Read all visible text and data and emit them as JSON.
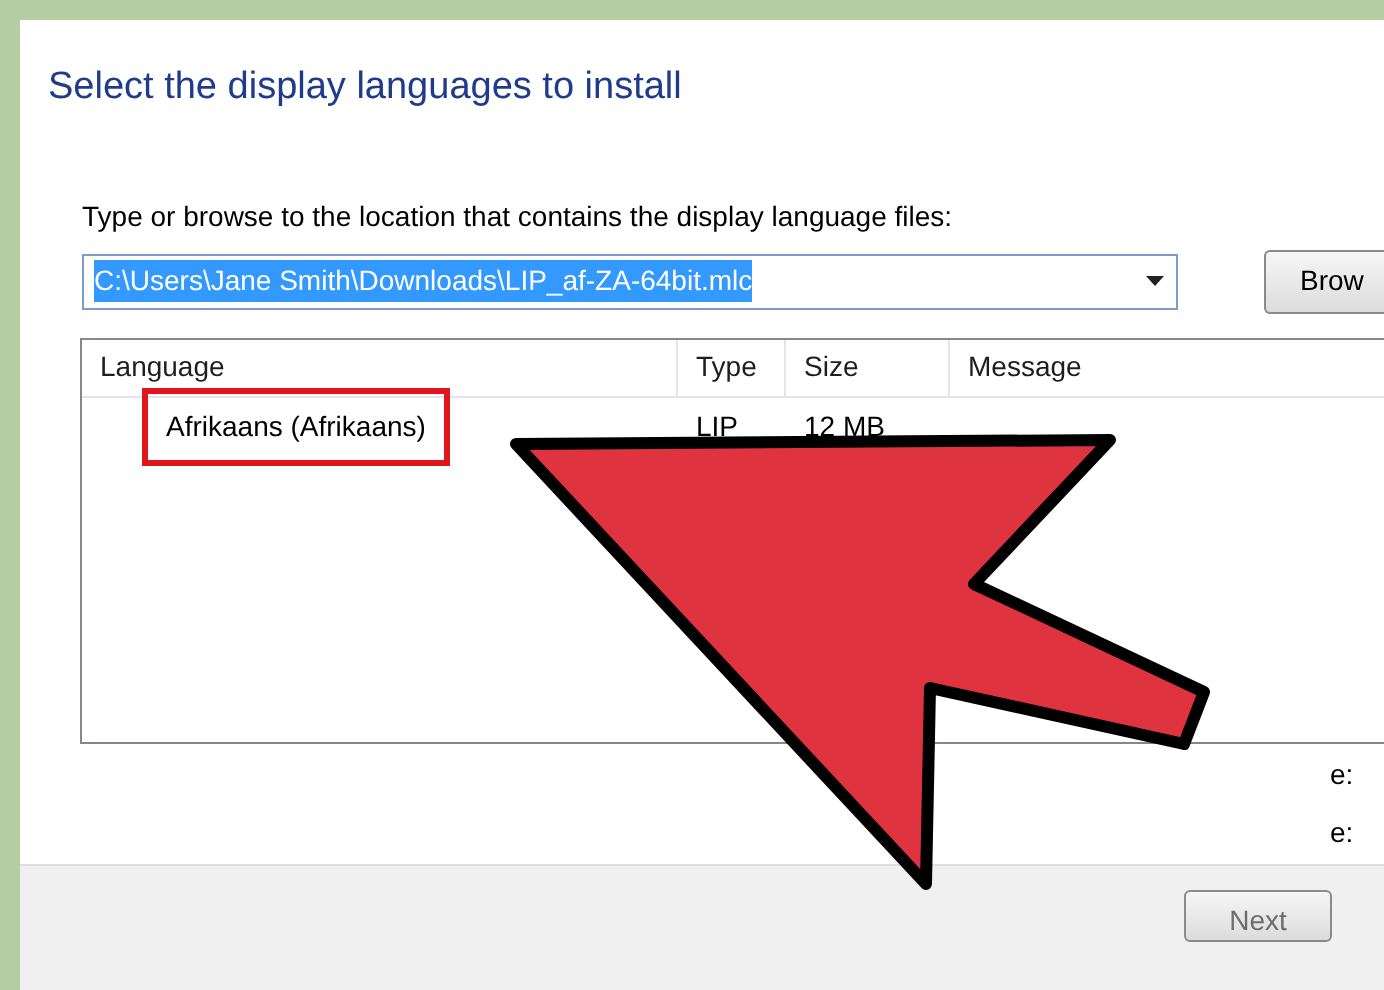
{
  "heading": "Select the display languages to install",
  "path_label": "Type or browse to the location that contains the display language files:",
  "path_field": {
    "value": "C:\\Users\\Jane Smith\\Downloads\\LIP_af-ZA-64bit.mlc",
    "text_selected": true
  },
  "browse_button": "Brow",
  "table": {
    "columns": [
      "Language",
      "Type",
      "Size",
      "Message"
    ],
    "rows": [
      {
        "language": "Afrikaans (Afrikaans)",
        "type": "LIP",
        "size": "12 MB",
        "outlined": true
      }
    ]
  },
  "side_labels": [
    "e:",
    "e:"
  ],
  "next_button": "Next"
}
